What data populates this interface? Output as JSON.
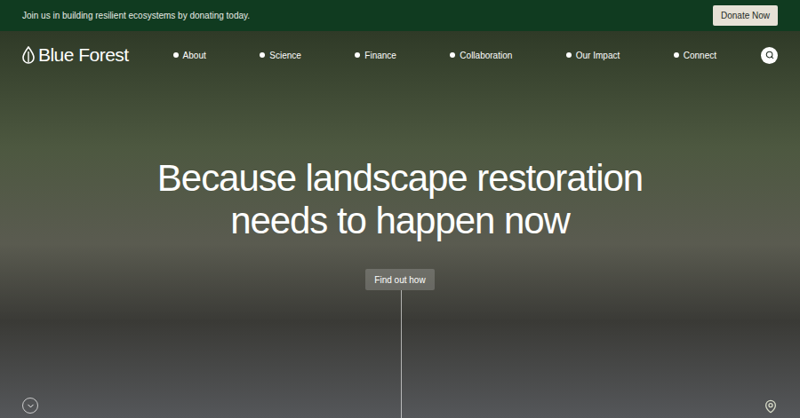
{
  "announcement": {
    "text": "Join us in building resilient ecosystems by donating today.",
    "button": "Donate Now"
  },
  "logo": {
    "text": "Blue Forest"
  },
  "nav": {
    "items": [
      {
        "label": "About"
      },
      {
        "label": "Science"
      },
      {
        "label": "Finance"
      },
      {
        "label": "Collaboration"
      },
      {
        "label": "Our Impact"
      },
      {
        "label": "Connect"
      }
    ]
  },
  "hero": {
    "headline": "Because landscape restoration needs to happen now",
    "cta": "Find out how"
  }
}
